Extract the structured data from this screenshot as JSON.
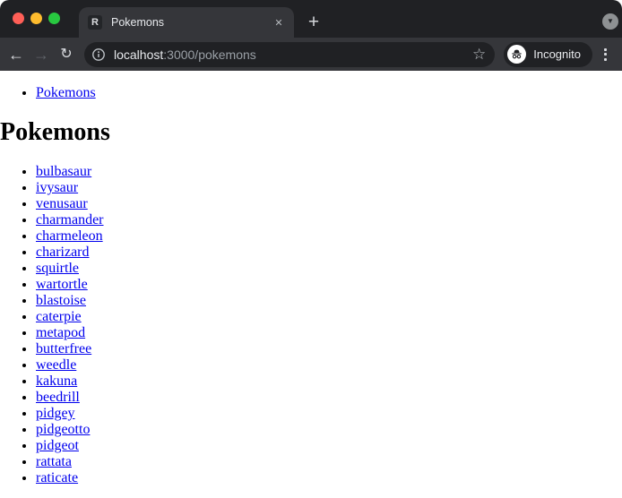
{
  "browser": {
    "tab_title": "Pokemons",
    "url": {
      "host": "localhost",
      "path": ":3000/pokemons"
    },
    "incognito_label": "Incognito",
    "icons": {
      "back": "←",
      "forward": "→",
      "refresh": "↻",
      "new_tab": "+",
      "close_tab": "✕",
      "bookmark_star": "☆",
      "tab_overflow_chevron": "▼",
      "favicon_letter": "R"
    },
    "colors": {
      "frame": "#202124",
      "toolbar": "#35363a",
      "field": "#202124",
      "text_primary": "#e8eaed",
      "text_secondary": "#9aa0a6",
      "traffic_red": "#ff5f57",
      "traffic_yellow": "#febc2e",
      "traffic_green": "#28c840"
    }
  },
  "page": {
    "nav_links": [
      "Pokemons"
    ],
    "heading": "Pokemons",
    "link_color": "#0000ee",
    "pokemon_links": [
      "bulbasaur",
      "ivysaur",
      "venusaur",
      "charmander",
      "charmeleon",
      "charizard",
      "squirtle",
      "wartortle",
      "blastoise",
      "caterpie",
      "metapod",
      "butterfree",
      "weedle",
      "kakuna",
      "beedrill",
      "pidgey",
      "pidgeotto",
      "pidgeot",
      "rattata",
      "raticate"
    ]
  }
}
